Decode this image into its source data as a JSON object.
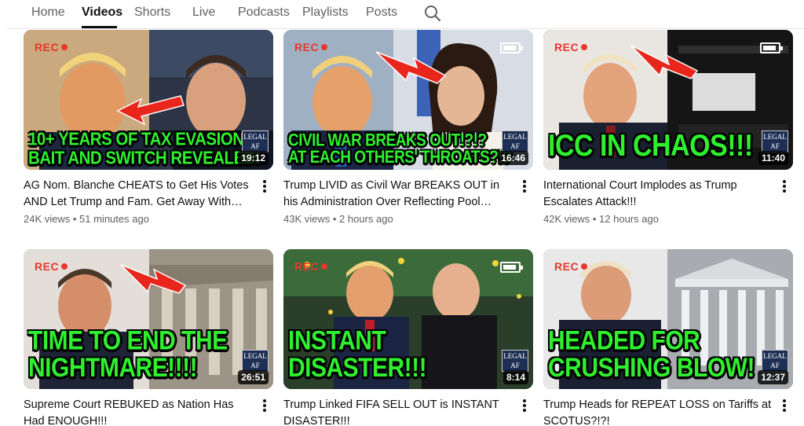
{
  "tabs": [
    {
      "label": "Home",
      "active": false
    },
    {
      "label": "Videos",
      "active": true
    },
    {
      "label": "Shorts",
      "active": false
    },
    {
      "label": "Live",
      "active": false
    },
    {
      "label": "Podcasts",
      "active": false
    },
    {
      "label": "Playlists",
      "active": false
    },
    {
      "label": "Posts",
      "active": false
    }
  ],
  "search_icon": "search-icon",
  "thumbnail_common": {
    "rec_label": "REC",
    "badge_line1": "LEGAL",
    "badge_line2": "AF"
  },
  "videos": [
    {
      "overlay_lines": [
        "10+ YEARS OF TAX EVASION!?",
        "BAIT AND SWITCH REVEALED!"
      ],
      "duration": "19:12",
      "title": "AG Nom. Blanche CHEATS to Get His Votes AND Let Trump and Fam. Get Away With Ta…",
      "views": "24K views",
      "age": "51 minutes ago"
    },
    {
      "overlay_lines": [
        "CIVIL WAR BREAKS OUT!?!?",
        "AT EACH OTHERS' THROATS?!?"
      ],
      "duration": "16:46",
      "title": "Trump LIVID as Civil War BREAKS OUT in his Administration Over Reflecting Pool Cover-…",
      "views": "43K views",
      "age": "2 hours ago"
    },
    {
      "overlay_lines": [
        "ICC IN CHAOS!!!"
      ],
      "duration": "11:40",
      "title": "International Court Implodes as Trump Escalates Attack!!!",
      "views": "42K views",
      "age": "12 hours ago"
    },
    {
      "overlay_lines": [
        "TIME TO END THE",
        "NIGHTMARE!!!!"
      ],
      "duration": "26:51",
      "title": "Supreme Court REBUKED as Nation Has Had ENOUGH!!!",
      "views": "",
      "age": ""
    },
    {
      "overlay_lines": [
        "INSTANT",
        "DISASTER!!!"
      ],
      "duration": "8:14",
      "title": "Trump Linked FIFA SELL OUT is INSTANT DISASTER!!!",
      "views": "",
      "age": ""
    },
    {
      "overlay_lines": [
        "HEADED FOR",
        "CRUSHING BLOW!"
      ],
      "duration": "12:37",
      "title": "Trump Heads for REPEAT LOSS on Tariffs at SCOTUS?!?!",
      "views": "",
      "age": ""
    }
  ],
  "colors": {
    "overlay_text": "#2ef02e",
    "rec": "#e8372c",
    "arrow": "#e8261c",
    "badge_bg": "#1d2f55"
  }
}
